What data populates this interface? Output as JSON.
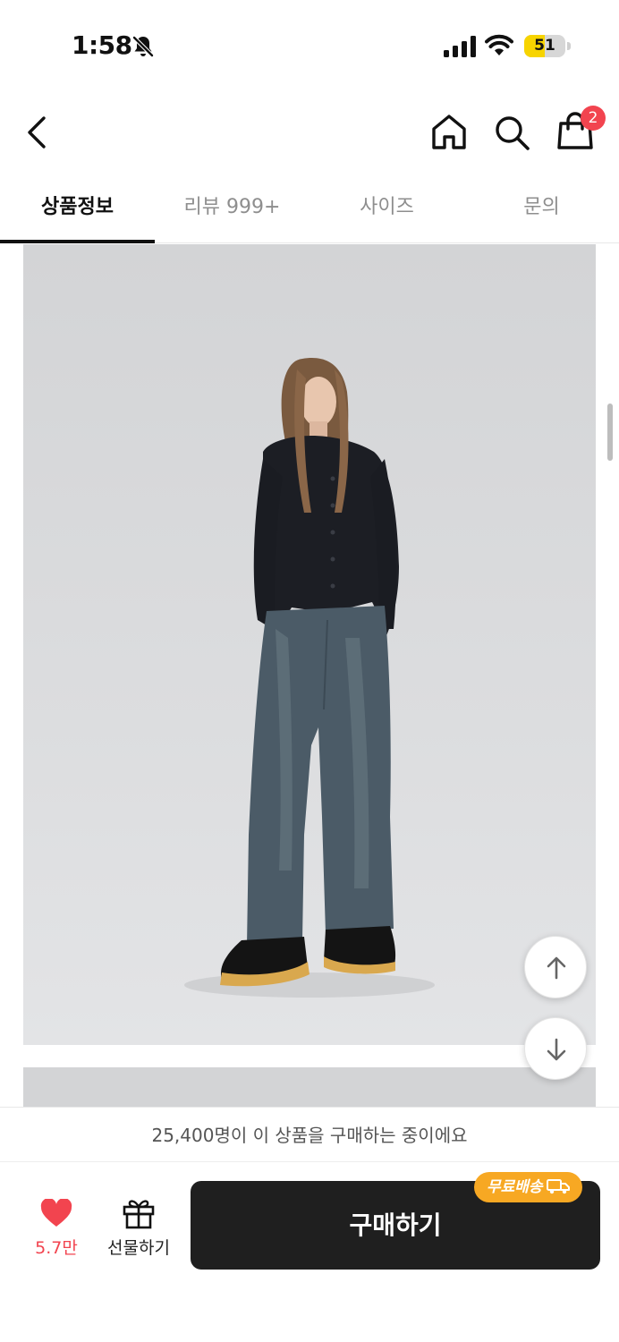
{
  "status_bar": {
    "time": "1:58",
    "battery": "51",
    "battery_level": 0.51,
    "icons": [
      "bell-off-icon",
      "cellular-signal-icon",
      "wifi-icon",
      "battery-icon"
    ]
  },
  "header": {
    "icons": [
      "back-chevron-icon",
      "home-icon",
      "search-icon",
      "shopping-bag-icon"
    ],
    "cart_badge": "2"
  },
  "tabs": [
    {
      "label": "상품정보",
      "active": true
    },
    {
      "label": "리뷰 999+",
      "active": false
    },
    {
      "label": "사이즈",
      "active": false
    },
    {
      "label": "문의",
      "active": false
    }
  ],
  "scroll_buttons": {
    "icons": [
      "arrow-up-icon",
      "arrow-down-icon"
    ]
  },
  "notice": {
    "text": "25,400명이 이 상품을 구매하는 중이에요"
  },
  "bottom_bar": {
    "like_count": "5.7만",
    "gift_label": "선물하기",
    "buy_label": "구매하기",
    "free_shipping_badge": "무료배송",
    "icons": [
      "heart-icon",
      "gift-icon",
      "truck-icon"
    ]
  },
  "colors": {
    "accent_red": "#f2444f",
    "badge_orange": "#f7a823",
    "buy_button": "#1f1f1f",
    "battery_yellow": "#f7d400"
  }
}
